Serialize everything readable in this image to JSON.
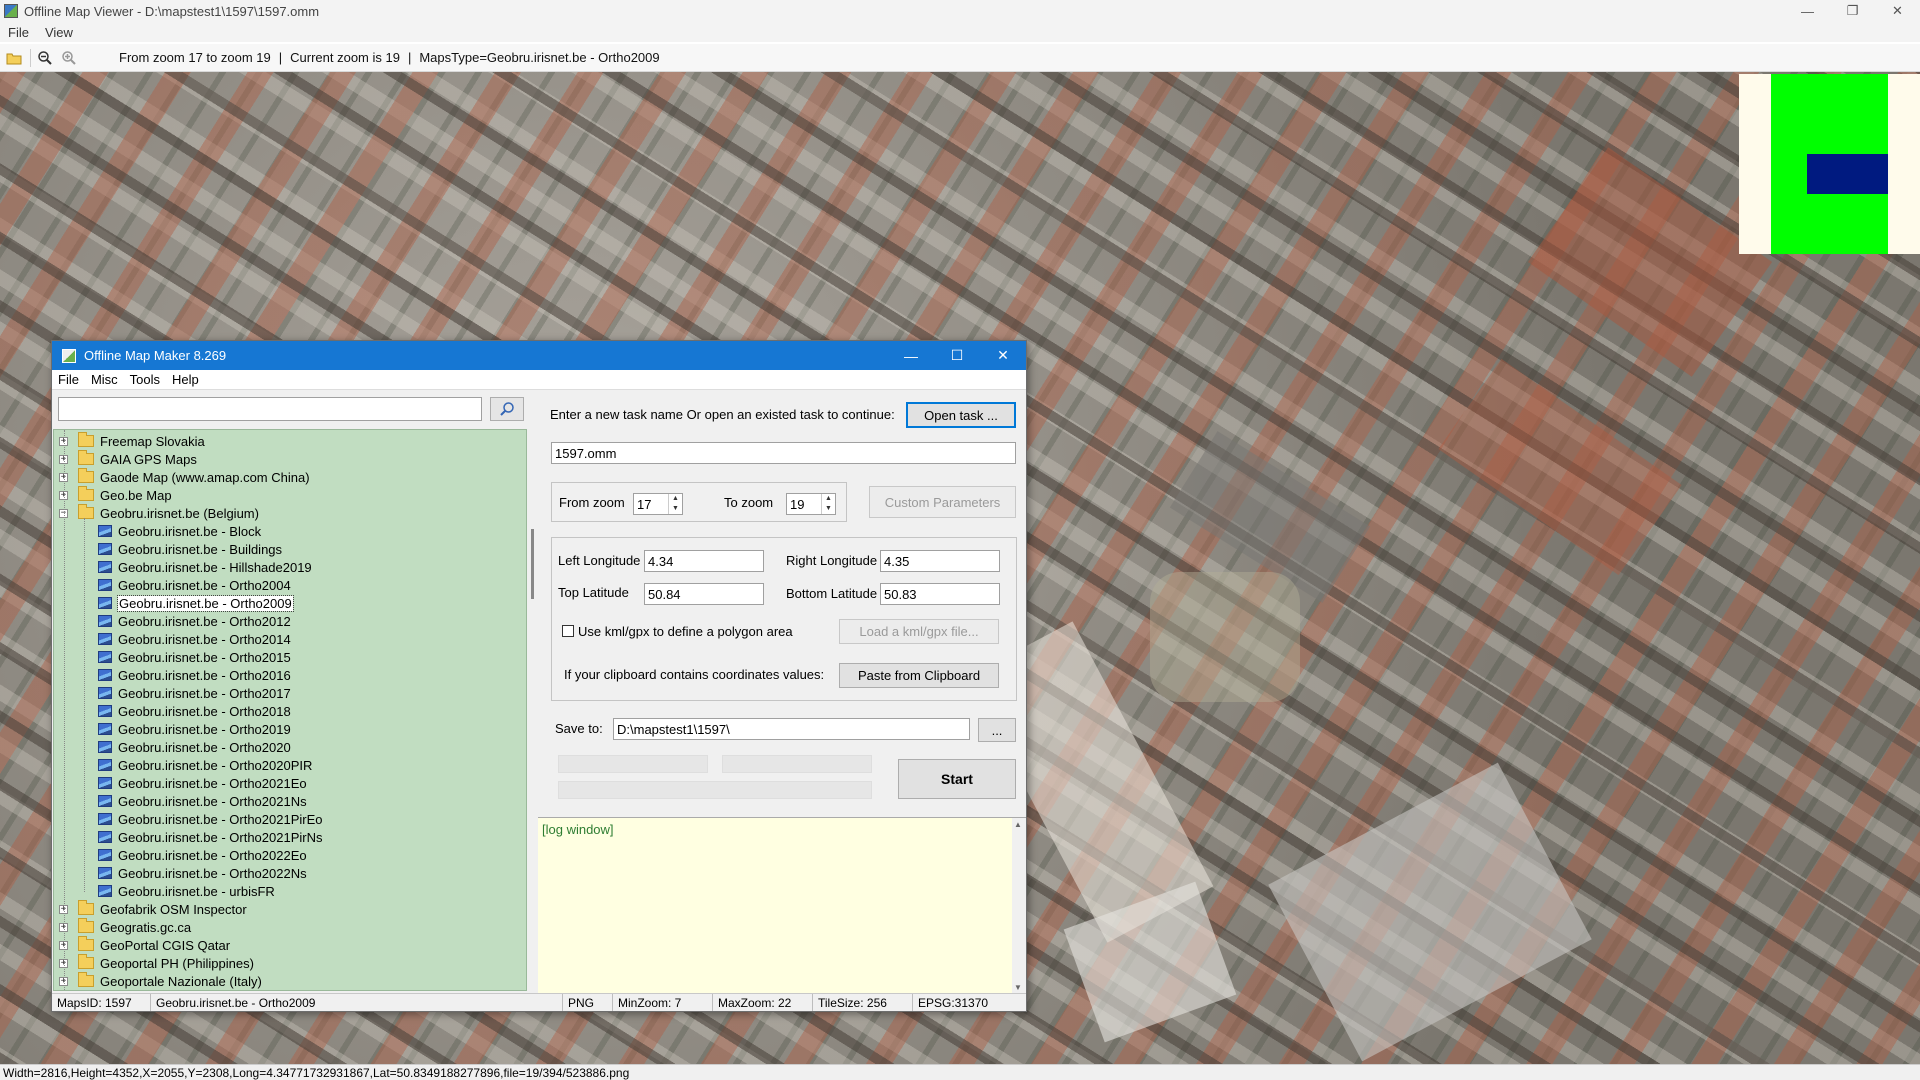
{
  "outer_window": {
    "title": "Offline Map Viewer - D:\\mapstest1\\1597\\1597.omm",
    "menu": [
      "File",
      "View"
    ],
    "toolbar_info": {
      "zoom_range": "From zoom 17 to zoom 19",
      "sep1": "|",
      "current_zoom": "Current zoom is 19",
      "sep2": "|",
      "maps_type": "MapsType=Geobru.irisnet.be - Ortho2009"
    },
    "status_text": "Width=2816,Height=4352,X=2055,Y=2308,Long=4.34771732931867,Lat=50.8349188277896,file=19/394/523886.png"
  },
  "minimap": {
    "background": "#fffbeb",
    "area_color": "#00ff00",
    "viewport_color": "#001a80"
  },
  "dialog": {
    "title": "Offline Map Maker 8.269",
    "menu": [
      "File",
      "Misc",
      "Tools",
      "Help"
    ],
    "search": {
      "value": "",
      "placeholder": ""
    },
    "tree": [
      {
        "label": "Freemap Slovakia",
        "kind": "folder",
        "expander": "+"
      },
      {
        "label": "GAIA GPS Maps",
        "kind": "folder",
        "expander": "+"
      },
      {
        "label": "Gaode Map (www.amap.com China)",
        "kind": "folder",
        "expander": "+"
      },
      {
        "label": "Geo.be Map",
        "kind": "folder",
        "expander": "+"
      },
      {
        "label": "Geobru.irisnet.be (Belgium)",
        "kind": "folder-open",
        "expander": "−"
      },
      {
        "label": "Geobru.irisnet.be - Block",
        "kind": "map"
      },
      {
        "label": "Geobru.irisnet.be - Buildings",
        "kind": "map"
      },
      {
        "label": "Geobru.irisnet.be - Hillshade2019",
        "kind": "map"
      },
      {
        "label": "Geobru.irisnet.be - Ortho2004",
        "kind": "map"
      },
      {
        "label": "Geobru.irisnet.be - Ortho2009",
        "kind": "map",
        "selected": true
      },
      {
        "label": "Geobru.irisnet.be - Ortho2012",
        "kind": "map"
      },
      {
        "label": "Geobru.irisnet.be - Ortho2014",
        "kind": "map"
      },
      {
        "label": "Geobru.irisnet.be - Ortho2015",
        "kind": "map"
      },
      {
        "label": "Geobru.irisnet.be - Ortho2016",
        "kind": "map"
      },
      {
        "label": "Geobru.irisnet.be - Ortho2017",
        "kind": "map"
      },
      {
        "label": "Geobru.irisnet.be - Ortho2018",
        "kind": "map"
      },
      {
        "label": "Geobru.irisnet.be - Ortho2019",
        "kind": "map"
      },
      {
        "label": "Geobru.irisnet.be - Ortho2020",
        "kind": "map"
      },
      {
        "label": "Geobru.irisnet.be - Ortho2020PIR",
        "kind": "map"
      },
      {
        "label": "Geobru.irisnet.be - Ortho2021Eo",
        "kind": "map"
      },
      {
        "label": "Geobru.irisnet.be - Ortho2021Ns",
        "kind": "map"
      },
      {
        "label": "Geobru.irisnet.be - Ortho2021PirEo",
        "kind": "map"
      },
      {
        "label": "Geobru.irisnet.be - Ortho2021PirNs",
        "kind": "map"
      },
      {
        "label": "Geobru.irisnet.be - Ortho2022Eo",
        "kind": "map"
      },
      {
        "label": "Geobru.irisnet.be - Ortho2022Ns",
        "kind": "map"
      },
      {
        "label": "Geobru.irisnet.be - urbisFR",
        "kind": "map"
      },
      {
        "label": "Geofabrik OSM Inspector",
        "kind": "folder",
        "expander": "+"
      },
      {
        "label": "Geogratis.gc.ca",
        "kind": "folder",
        "expander": "+"
      },
      {
        "label": "GeoPortal CGIS Qatar",
        "kind": "folder",
        "expander": "+"
      },
      {
        "label": "Geoportal PH (Philippines)",
        "kind": "folder",
        "expander": "+"
      },
      {
        "label": "Geoportale Nazionale (Italy)",
        "kind": "folder",
        "expander": "+"
      }
    ],
    "task": {
      "prompt": "Enter a new task name Or open an existed task to continue:",
      "open_button": "Open task ...",
      "name_value": "1597.omm"
    },
    "zoom": {
      "from_label": "From zoom",
      "from_value": "17",
      "to_label": "To zoom",
      "to_value": "19",
      "custom_button": "Custom Parameters"
    },
    "coords": {
      "left_lon_label": "Left Longitude",
      "left_lon_value": "4.34",
      "right_lon_label": "Right Longitude",
      "right_lon_value": "4.35",
      "top_lat_label": "Top Latitude",
      "top_lat_value": "50.84",
      "bottom_lat_label": "Bottom Latitude",
      "bottom_lat_value": "50.83",
      "kml_checkbox_label": "Use kml/gpx to define a polygon area",
      "kml_checked": false,
      "load_kml_button": "Load a kml/gpx file...",
      "clipboard_label": "If your clipboard contains coordinates values:",
      "paste_button": "Paste from Clipboard"
    },
    "save": {
      "label": "Save to:",
      "value": "D:\\mapstest1\\1597\\",
      "browse_button": "..."
    },
    "start_button": "Start",
    "log_text": "[log window]",
    "status": {
      "maps_id": "MapsID: 1597",
      "map_name": "Geobru.irisnet.be - Ortho2009",
      "format": "PNG",
      "min_zoom": "MinZoom: 7",
      "max_zoom": "MaxZoom: 22",
      "tile_size": "TileSize: 256",
      "epsg": "EPSG:31370"
    }
  }
}
